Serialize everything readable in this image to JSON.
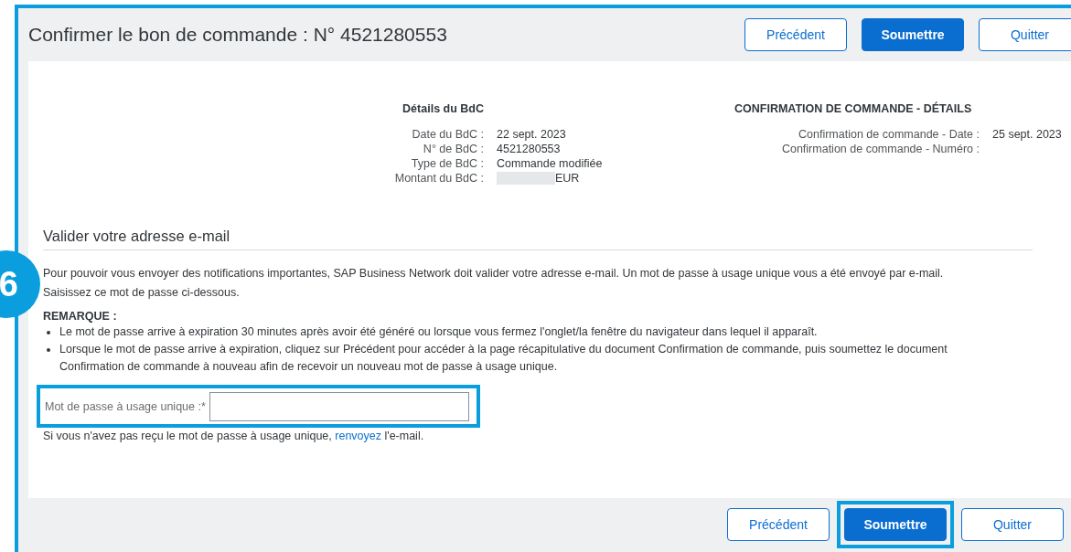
{
  "page_highlighted": true,
  "step_badge": "6",
  "header": {
    "title": "Confirmer le bon de commande : N° 4521280553",
    "buttons": [
      {
        "label": "Précédent",
        "kind": "secondary",
        "highlighted": false
      },
      {
        "label": "Soumettre",
        "kind": "primary",
        "highlighted": false
      },
      {
        "label": "Quitter",
        "kind": "secondary",
        "highlighted": false
      }
    ]
  },
  "po_details": {
    "heading": "Détails du BdC",
    "rows": [
      {
        "label": "Date du BdC :",
        "value": "22 sept. 2023",
        "redacted": false
      },
      {
        "label": "N° de BdC :",
        "value": "4521280553",
        "redacted": false
      },
      {
        "label": "Type de BdC :",
        "value": "Commande modifiée",
        "redacted": false
      },
      {
        "label": "Montant du BdC :",
        "value": "EUR",
        "redacted": true
      }
    ]
  },
  "confirmation_details": {
    "heading": "CONFIRMATION DE COMMANDE - DÉTAILS",
    "rows": [
      {
        "label": "Confirmation de commande - Date :",
        "value": "25 sept. 2023"
      },
      {
        "label": "Confirmation de commande - Numéro  :"
      }
    ]
  },
  "email_validation": {
    "title": "Valider votre adresse e-mail",
    "intro": "Pour pouvoir vous envoyer des notifications importantes, SAP Business Network doit valider votre adresse e-mail. Un mot de passe à usage unique vous a été envoyé par e-mail. Saisissez ce mot de passe ci-dessous.",
    "note_heading": "REMARQUE :",
    "notes": [
      "Le mot de passe arrive à expiration 30 minutes après avoir été généré ou lorsque vous fermez l'onglet/la fenêtre du navigateur dans lequel il apparaît.",
      "Lorsque le mot de passe arrive à expiration, cliquez sur Précédent pour accéder à la page récapitulative du document Confirmation de commande, puis soumettez le document Confirmation de commande à nouveau afin de recevoir un nouveau mot de passe à usage unique."
    ],
    "password": {
      "label": "Mot de passe à usage unique :*",
      "highlighted": true
    },
    "resend": {
      "before": "Si vous n'avez pas reçu le mot de passe à usage unique,",
      "link": "renvoyez",
      "after": "l'e-mail."
    }
  },
  "footer": {
    "buttons": [
      {
        "label": "Précédent",
        "kind": "secondary",
        "highlighted": false
      },
      {
        "label": "Soumettre",
        "kind": "primary",
        "highlighted": true
      },
      {
        "label": "Quitter",
        "kind": "secondary",
        "highlighted": false
      }
    ]
  }
}
